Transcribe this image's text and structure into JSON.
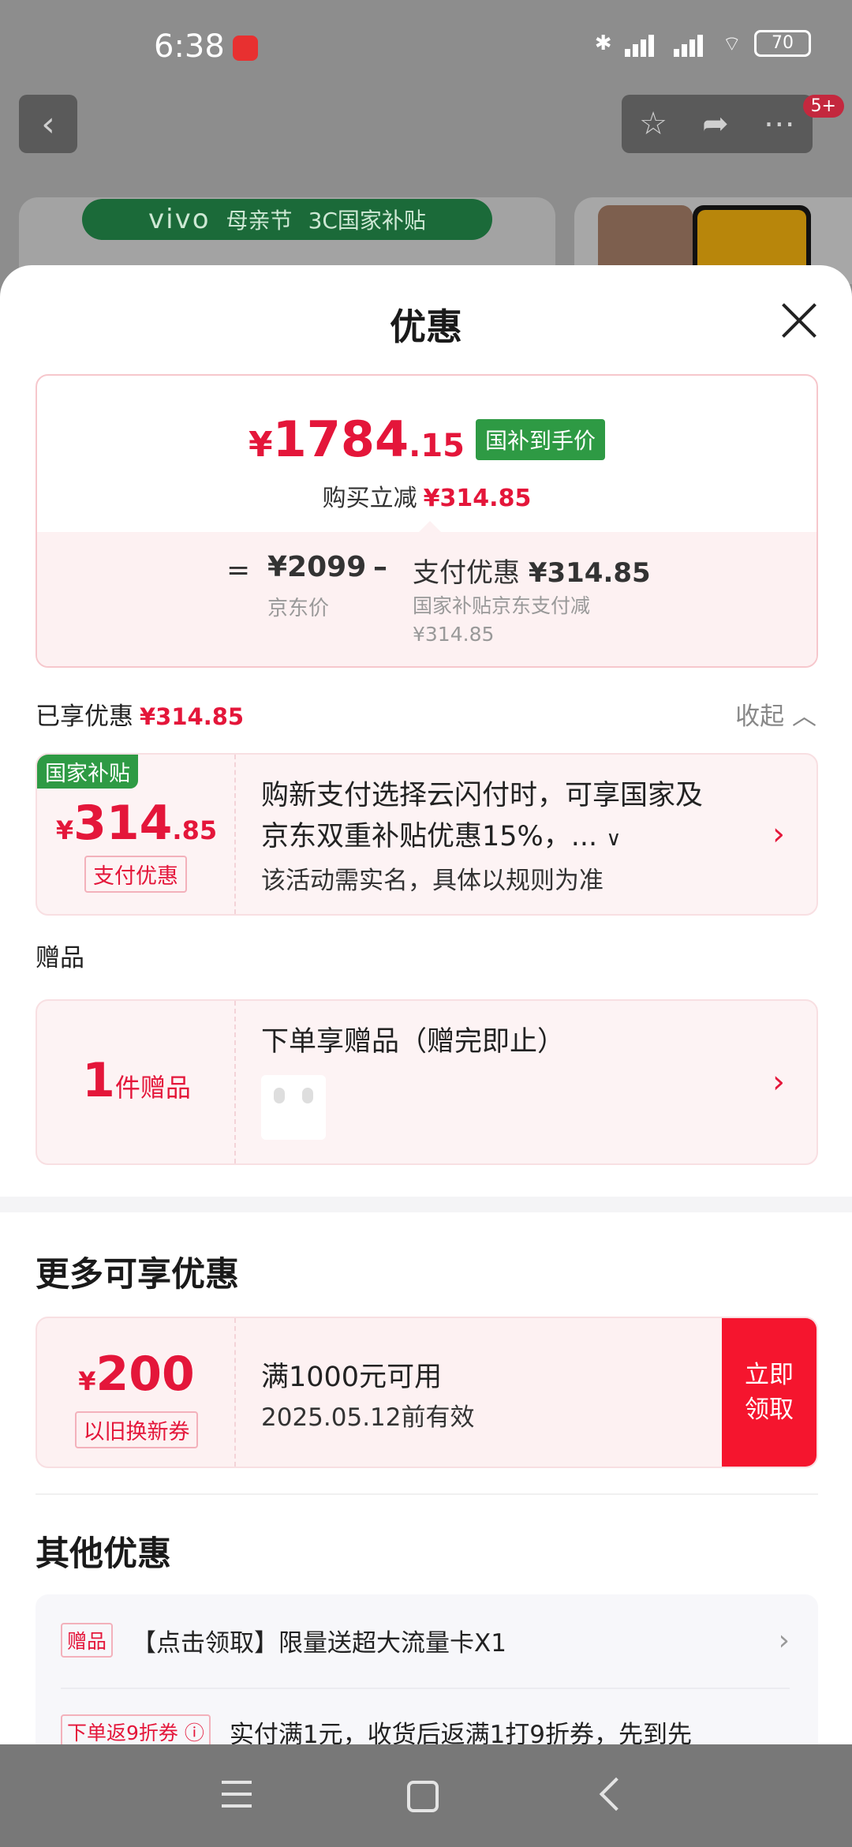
{
  "status_bar": {
    "time": "6:38",
    "battery": "70"
  },
  "top_nav": {
    "badge": "5+"
  },
  "promo": {
    "brand": "vivo",
    "festival": "母亲节",
    "subsidy": "3C国家补贴"
  },
  "sheet": {
    "title": "优惠",
    "price": {
      "currency": "¥",
      "main_int": "1784",
      "main_dec": ".15",
      "tag": "国补到手价",
      "instant_label": "购买立减",
      "instant_amount": "¥314.85",
      "equals": "=",
      "jd_price": "¥2099",
      "jd_label": "京东价",
      "minus": "–",
      "pay_label": "支付优惠",
      "pay_amount": "¥314.85",
      "pay_desc_line1": "国家补贴京东支付减",
      "pay_desc_line2": "¥314.85"
    },
    "enjoyed": {
      "label": "已享优惠",
      "amount": "¥314.85",
      "collapse": "收起"
    },
    "subsidy_coupon": {
      "corner_tag": "国家补贴",
      "currency": "¥",
      "amount_int": "314",
      "amount_dec": ".85",
      "type": "支付优惠",
      "line1": "购新支付选择云闪付时，可享国家及",
      "line2": "京东双重补贴优惠15%，...",
      "line3": "该活动需实名，具体以规则为准"
    },
    "gift": {
      "heading": "赠品",
      "count": "1",
      "count_unit": "件赠品",
      "title": "下单享赠品（赠完即止）"
    },
    "more": {
      "title": "更多可享优惠",
      "voucher": {
        "currency": "¥",
        "amount": "200",
        "type": "以旧换新券",
        "rule": "满1000元可用",
        "valid": "2025.05.12前有效",
        "cta": "立即领取"
      }
    },
    "other": {
      "title": "其他优惠",
      "rows": [
        {
          "tag": "赠品",
          "text": "【点击领取】限量送超大流量卡X1"
        },
        {
          "tag": "下单返9折券 ⓘ",
          "text": "实付满1元，收货后返满1打9折券，先到先"
        }
      ]
    }
  }
}
